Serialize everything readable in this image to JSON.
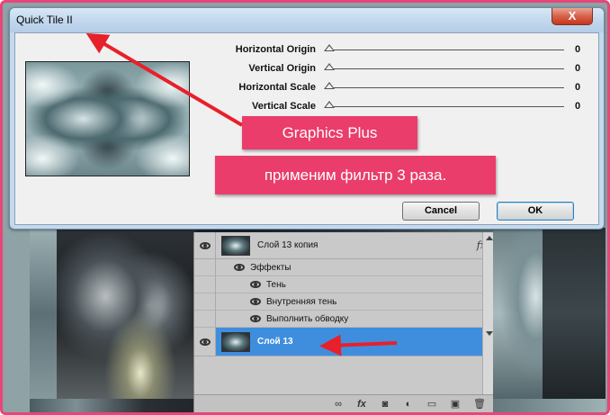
{
  "dialog": {
    "title": "Quick Tile II",
    "close_label": "X",
    "sliders": [
      {
        "label": "Horizontal Origin",
        "value": "0"
      },
      {
        "label": "Vertical Origin",
        "value": "0"
      },
      {
        "label": "Horizontal Scale",
        "value": "0"
      },
      {
        "label": "Vertical Scale",
        "value": "0"
      }
    ],
    "cancel_label": "Cancel",
    "ok_label": "OK"
  },
  "callouts": {
    "plugin_name": "Graphics Plus",
    "instruction": "применим фильтр 3 раза."
  },
  "layers": {
    "copy_layer_name": "Слой 13 копия",
    "fx_label": "fx",
    "effects_label": "Эффекты",
    "effects": [
      "Тень",
      "Внутренняя тень",
      "Выполнить обводку"
    ],
    "selected_layer_name": "Слой 13",
    "bottom_icons": [
      "link-icon",
      "fx-icon",
      "mask-icon",
      "adjustment-icon",
      "folder-icon",
      "new-layer-icon",
      "trash-icon"
    ],
    "bottom_glyphs": [
      "∞",
      "fx",
      "◙",
      "◐",
      "▭",
      "▣",
      "🗑"
    ]
  },
  "colors": {
    "callout": "#ea3d6b",
    "arrow": "#e8202a",
    "selected_layer": "#3f8ede",
    "frame": "#e8457a"
  }
}
